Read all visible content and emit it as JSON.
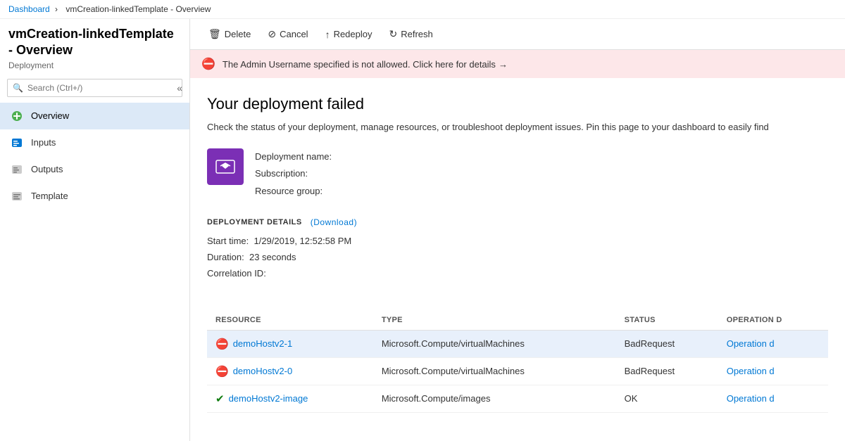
{
  "breadcrumb": {
    "items": [
      {
        "label": "Dashboard",
        "type": "link"
      },
      {
        "label": ">",
        "type": "separator"
      },
      {
        "label": "vmCreation-linkedTemplate - Overview",
        "type": "current"
      }
    ]
  },
  "page": {
    "title": "vmCreation-linkedTemplate - Overview",
    "subtitle": "Deployment"
  },
  "search": {
    "placeholder": "Search (Ctrl+/)"
  },
  "sidebar": {
    "nav": [
      {
        "id": "overview",
        "label": "Overview",
        "icon": "overview",
        "active": true
      },
      {
        "id": "inputs",
        "label": "Inputs",
        "icon": "inputs",
        "active": false
      },
      {
        "id": "outputs",
        "label": "Outputs",
        "icon": "outputs",
        "active": false
      },
      {
        "id": "template",
        "label": "Template",
        "icon": "template",
        "active": false
      }
    ]
  },
  "toolbar": {
    "buttons": [
      {
        "id": "delete",
        "label": "Delete",
        "icon": "trash"
      },
      {
        "id": "cancel",
        "label": "Cancel",
        "icon": "cancel"
      },
      {
        "id": "redeploy",
        "label": "Redeploy",
        "icon": "redeploy"
      },
      {
        "id": "refresh",
        "label": "Refresh",
        "icon": "refresh"
      }
    ]
  },
  "alert": {
    "message": "The Admin Username specified is not allowed. Click here for details",
    "arrow": "→"
  },
  "deployment": {
    "heading": "Your deployment failed",
    "description": "Check the status of your deployment, manage resources, or troubleshoot deployment issues. Pin this page to your dashboard to easily find",
    "fields": {
      "name_label": "Deployment name:",
      "name_value": "",
      "subscription_label": "Subscription:",
      "subscription_value": "",
      "resource_group_label": "Resource group:",
      "resource_group_value": ""
    },
    "details_header": "DEPLOYMENT DETAILS",
    "download_label": "(Download)",
    "start_time_label": "Start time:",
    "start_time_value": "1/29/2019, 12:52:58 PM",
    "duration_label": "Duration:",
    "duration_value": "23 seconds",
    "correlation_label": "Correlation ID:",
    "correlation_value": ""
  },
  "table": {
    "columns": [
      {
        "id": "resource",
        "label": "RESOURCE"
      },
      {
        "id": "type",
        "label": "TYPE"
      },
      {
        "id": "status",
        "label": "STATUS"
      },
      {
        "id": "operation",
        "label": "OPERATION D"
      }
    ],
    "rows": [
      {
        "status_icon": "error",
        "resource": "demoHostv2-1",
        "type": "Microsoft.Compute/virtualMachines",
        "status": "BadRequest",
        "operation": "Operation d",
        "selected": true
      },
      {
        "status_icon": "error",
        "resource": "demoHostv2-0",
        "type": "Microsoft.Compute/virtualMachines",
        "status": "BadRequest",
        "operation": "Operation d",
        "selected": false
      },
      {
        "status_icon": "success",
        "resource": "demoHostv2-image",
        "type": "Microsoft.Compute/images",
        "status": "OK",
        "operation": "Operation d",
        "selected": false
      }
    ]
  }
}
